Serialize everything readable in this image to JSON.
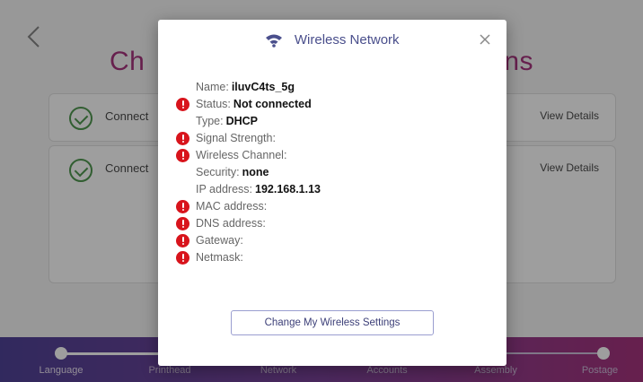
{
  "background": {
    "title_left": "Ch",
    "title_right": "ns",
    "connections": [
      {
        "label": "Connect",
        "action": "View Details"
      },
      {
        "label": "Connect",
        "action": "View Details"
      }
    ],
    "steps": [
      "Language",
      "Printhead",
      "Network",
      "Accounts",
      "Assembly",
      "Postage"
    ],
    "colors": {
      "brand_magenta": "#9b1a6d",
      "footer_start": "#3a2a8a"
    }
  },
  "modal": {
    "title": "Wireless Network",
    "icon": "wifi-icon",
    "rows": [
      {
        "label": "Name:",
        "value": "iluvC4ts_5g",
        "alert": false
      },
      {
        "label": "Status:",
        "value": "Not connected",
        "alert": true
      },
      {
        "label": "Type:",
        "value": "DHCP",
        "alert": false
      },
      {
        "label": "Signal Strength:",
        "value": "",
        "alert": true
      },
      {
        "label": "Wireless Channel:",
        "value": "",
        "alert": true
      },
      {
        "label": "Security:",
        "value": "none",
        "alert": false
      },
      {
        "label": "IP address:",
        "value": "192.168.1.13",
        "alert": false
      },
      {
        "label": "MAC address:",
        "value": "",
        "alert": true
      },
      {
        "label": "DNS address:",
        "value": "",
        "alert": true
      },
      {
        "label": "Gateway:",
        "value": "",
        "alert": true
      },
      {
        "label": "Netmask:",
        "value": "",
        "alert": true
      }
    ],
    "button_label": "Change My Wireless Settings",
    "colors": {
      "alert": "#d8141c",
      "title": "#4a4f8c"
    }
  }
}
